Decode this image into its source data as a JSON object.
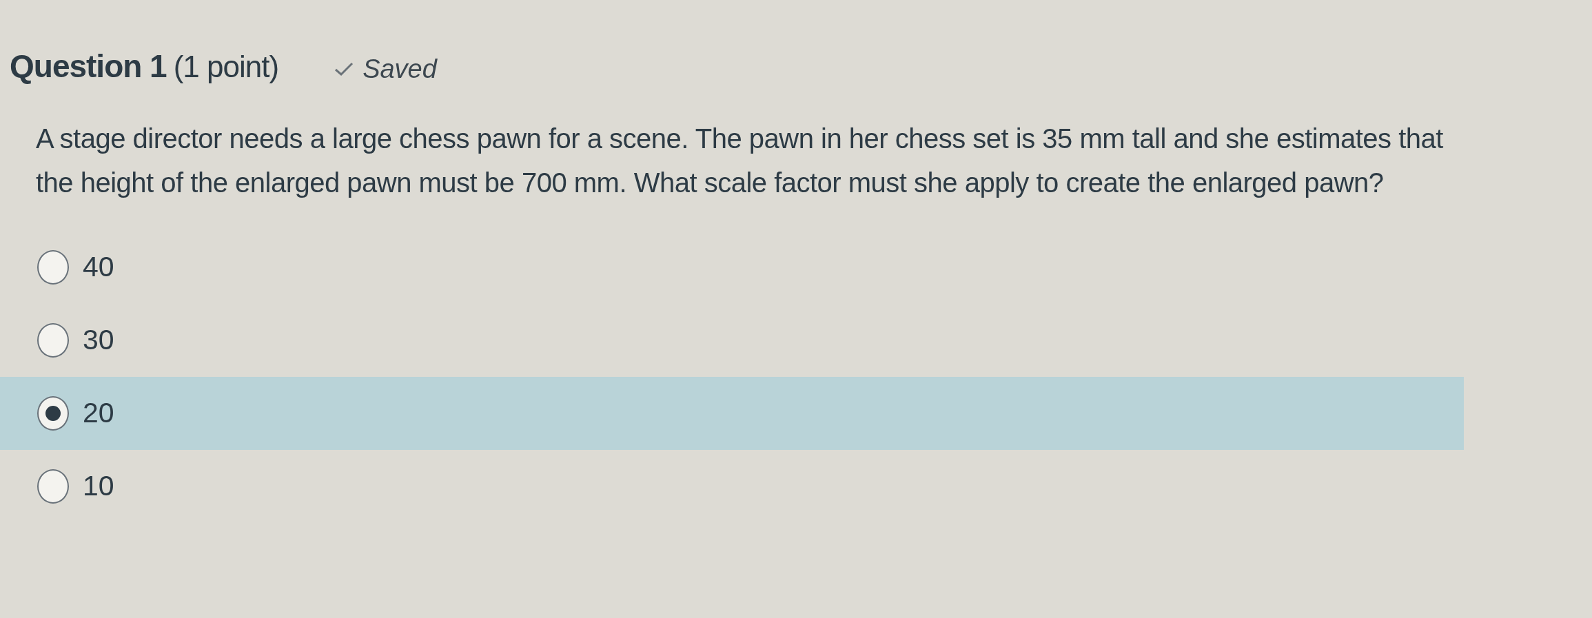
{
  "question": {
    "title": "Question 1",
    "points": "(1 point)",
    "status": "Saved",
    "text": "A stage director needs a large chess pawn for a scene. The pawn in her chess set is 35 mm tall and she estimates that the height of the enlarged pawn must be 700 mm. What scale factor must she apply to create the enlarged pawn?",
    "options": [
      {
        "label": "40",
        "selected": false
      },
      {
        "label": "30",
        "selected": false
      },
      {
        "label": "20",
        "selected": true
      },
      {
        "label": "10",
        "selected": false
      }
    ]
  }
}
